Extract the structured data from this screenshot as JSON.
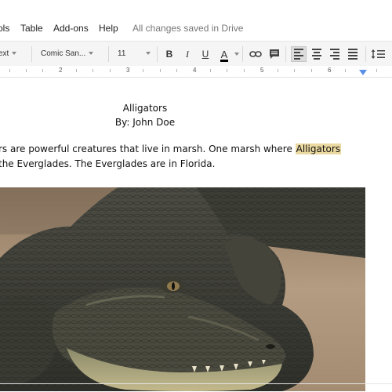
{
  "menu": {
    "items": [
      "ols",
      "Table",
      "Add-ons",
      "Help"
    ],
    "status": "All changes saved in Drive"
  },
  "toolbar": {
    "style_value": "ext",
    "font_value": "Comic San...",
    "size_value": "11",
    "bold_label": "B",
    "italic_label": "I",
    "underline_label": "U",
    "text_color_label": "A",
    "text_color": "#000000"
  },
  "ruler": {
    "numbers": [
      "2",
      "3",
      "4",
      "5",
      "6"
    ]
  },
  "document": {
    "title": "Alligators",
    "byline": "By: John Doe",
    "paragraph": {
      "line1_before": "rs are powerful creatures that live in marsh. One marsh where ",
      "line1_highlight": "Alligators",
      "line2": "the Everglades. The Everglades are in Florida."
    },
    "highlight_color": "#ead9a0"
  },
  "icons": {
    "link": "link-icon",
    "comment": "comment-icon",
    "align_left": "align-left-icon",
    "align_center": "align-center-icon",
    "align_right": "align-right-icon",
    "justify": "justify-icon",
    "line_spacing": "line-spacing-icon"
  }
}
